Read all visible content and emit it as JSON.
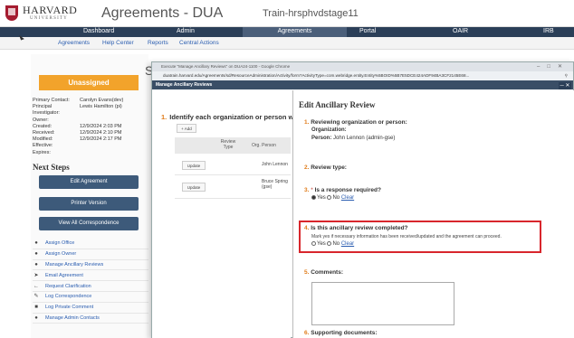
{
  "header": {
    "univ": "HARVARD",
    "univ_sub": "UNIVERSITY",
    "app_title": "Agreements - DUA",
    "store": "Train-hrsphvdstage11"
  },
  "nav": [
    "Dashboard",
    "Admin",
    "Agreements",
    "Portal",
    "OAIR",
    "IRB"
  ],
  "subnav": [
    "Agreements",
    "Help Center",
    "Reports",
    "Central Actions"
  ],
  "left": {
    "status": "Unassigned",
    "meta": [
      {
        "k": "Primary Contact:",
        "v": "Carolyn Evans(dev)"
      },
      {
        "k": "Principal Investigator:",
        "v": "Lewis Hamilton (pi)"
      },
      {
        "k": "Owner:",
        "v": ""
      },
      {
        "k": "Created:",
        "v": "12/9/2024 2:03 PM"
      },
      {
        "k": "Received:",
        "v": "12/9/2024 2:10 PM"
      },
      {
        "k": "Modified:",
        "v": "12/9/2024 2:17 PM"
      },
      {
        "k": "Effective:",
        "v": ""
      },
      {
        "k": "Expires:",
        "v": ""
      }
    ],
    "next_steps": "Next Steps",
    "buttons": [
      "Edit Agreement",
      "Printer Version",
      "View All Correspondence"
    ],
    "actions": [
      {
        "icon": "people-icon",
        "label": "Assign Office"
      },
      {
        "icon": "person-icon",
        "label": "Assign Owner"
      },
      {
        "icon": "people-icon",
        "label": "Manage Ancillary Reviews"
      },
      {
        "icon": "send-icon",
        "label": "Email Agreement"
      },
      {
        "icon": "arrow-left-icon",
        "label": "Request Clarification"
      },
      {
        "icon": "edit-icon",
        "label": "Log Correspondence"
      },
      {
        "icon": "comment-icon",
        "label": "Log Private Comment"
      },
      {
        "icon": "people-icon",
        "label": "Manage Admin Contacts"
      }
    ]
  },
  "behind": {
    "s": "S"
  },
  "window": {
    "title": "Execute \"Manage Ancillary Reviews\" on DUA24-1100 - Google Chrome",
    "url": "duatrain.harvard.edu/Agreements/sd/ResourceAdministration/Activity/form?ActivityType=com.webridge.entity.Entity%5BOID%5B7E5DCE424ADF94BA3CF2145E68...",
    "bar": "Manage Ancillary Reviews"
  },
  "popup_left": {
    "identify_num": "1.",
    "identify": "Identify each organization or person wi",
    "add": "+ Add",
    "headers": [
      "Review Type",
      "Org. Person"
    ],
    "rows": [
      {
        "button": "Update",
        "person": "John Lennon"
      },
      {
        "button": "Update",
        "person": "Bruce Spring (gse)"
      }
    ]
  },
  "dialog": {
    "title": "Edit Ancillary Review",
    "q1_num": "1.",
    "q1": "Reviewing organization or person:",
    "q1_org": "Organization:",
    "q1_person_label": "Person:",
    "q1_person": "John Lennon (admin-gse)",
    "q2_num": "2.",
    "q2": "Review type:",
    "q3_num": "3.",
    "q3": "Is a response required?",
    "q3_yes": "Yes",
    "q3_no": "No",
    "clear": "Clear",
    "q4_num": "4.",
    "q4": "Is this ancillary review completed?",
    "q4_help": "Mark yes if necessary information has been received/updated and the agreement can proceed.",
    "q4_yes": "Yes",
    "q4_no": "No",
    "q5_num": "5.",
    "q5": "Comments:",
    "q6_num": "6.",
    "q6": "Supporting documents:"
  },
  "colors": {
    "nav": "#2b3f58",
    "accent": "#f2a32b",
    "highlight": "#d8262c"
  }
}
